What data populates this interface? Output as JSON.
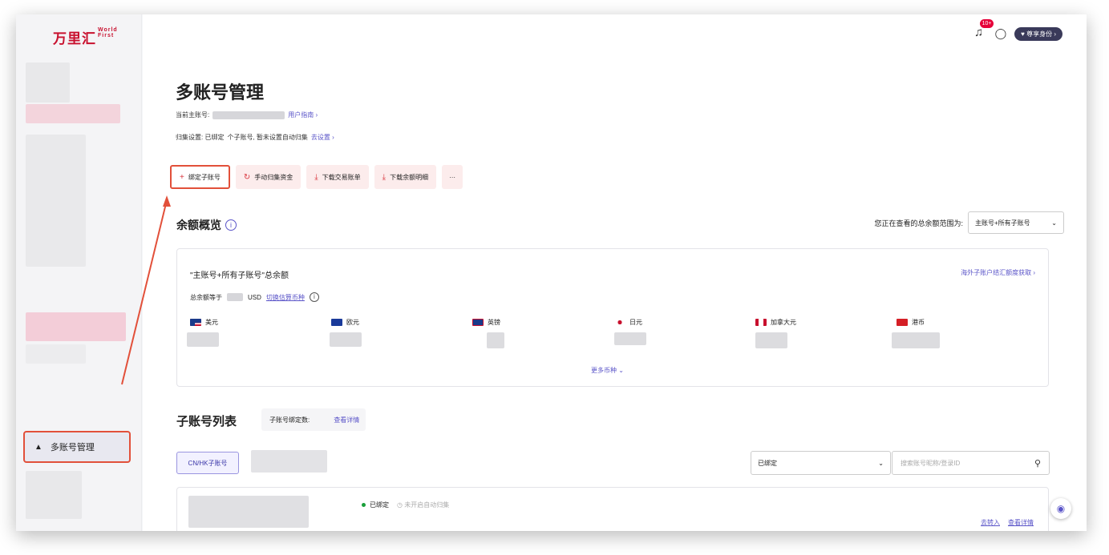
{
  "logo": {
    "text": "万里汇",
    "sub1": "World",
    "sub2": "First"
  },
  "sidebar": {
    "active_item": "多账号管理"
  },
  "topbar": {
    "badge": "10+",
    "identity": "尊享身份"
  },
  "page": {
    "title": "多账号管理",
    "current_main_label": "当前主账号:",
    "user_guide": "用户指南",
    "collect_text": "归集设置: 已绑定",
    "collect_text2": "个子账号, 暂未设置自动归集",
    "go_settings": "去设置"
  },
  "actions": {
    "bind": "绑定子账号",
    "manual": "手动归集资金",
    "download_tx": "下载交易账单",
    "download_balance": "下载余额明细",
    "more": "···"
  },
  "balance": {
    "title": "余额概览",
    "scope_label": "您正在查看的总余额范围为:",
    "scope_value": "主账号+所有子账号",
    "card_title": "\"主账号+所有子账号\"总余额",
    "overseas_link": "海外子账户结汇额度获取",
    "eq_label": "总余额等于",
    "eq_currency": "USD",
    "switch_link": "切换估算币种",
    "currencies": [
      "美元",
      "欧元",
      "英镑",
      "日元",
      "加拿大元",
      "港币"
    ],
    "more_currencies": "更多币种"
  },
  "subaccounts": {
    "title": "子账号列表",
    "bound_count_label": "子账号绑定数:",
    "view_details": "查看详情",
    "tab": "CN/HK子账号",
    "filter_value": "已绑定",
    "search_placeholder": "搜索账号昵称/登录ID",
    "status_bound": "已绑定",
    "status_auto": "未开启自动归集",
    "link_transfer": "去转入",
    "link_details": "查看详情"
  },
  "colors": {
    "brand": "#c8102e",
    "accent": "#5a54c8",
    "highlight": "#e2503a"
  }
}
